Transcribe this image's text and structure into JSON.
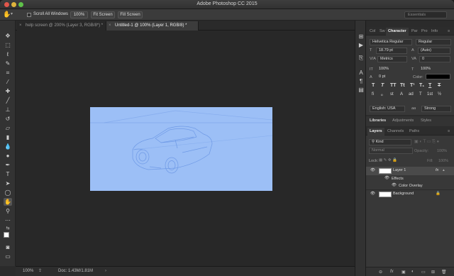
{
  "window": {
    "title": "Adobe Photoshop CC 2015"
  },
  "options_bar": {
    "scroll_all_label": "Scroll All Windows",
    "zoom_100_label": "100%",
    "fit_screen_label": "Fit Screen",
    "fill_screen_label": "Fill Screen",
    "workspace": "Essentials"
  },
  "doc_tabs": [
    {
      "label": "help screen @ 200% (Layer 3, RGB/8*) *",
      "active": false
    },
    {
      "label": "Untitled-1 @ 100% (Layer 1, RGB/8) *",
      "active": true
    }
  ],
  "status": {
    "zoom": "100%",
    "doc_info": "Doc: 1.43M/1.81M"
  },
  "character_panel": {
    "tabs": [
      "Col",
      "Sw",
      "Character",
      "Par",
      "Pro",
      "Info"
    ],
    "font_family": "Helvetica Regular",
    "font_style": "Regular",
    "font_size": "18.79 pt",
    "leading": "(Auto)",
    "kerning": "Metrics",
    "tracking": "0",
    "vertical_scale": "100%",
    "horizontal_scale": "100%",
    "baseline_shift": "0 pt",
    "color_label": "Color:",
    "style_buttons": [
      "T",
      "T",
      "TT",
      "Tt",
      "T¹",
      "T₁",
      "T",
      "T"
    ],
    "opentype_buttons": [
      "fi",
      "ℴ",
      "st",
      "A",
      "ad",
      "T",
      "1st",
      "½"
    ],
    "language": "English: USA",
    "antialias_icon": "aa",
    "antialias": "Strong"
  },
  "libraries_panel": {
    "tabs": [
      "Libraries",
      "Adjustments",
      "Styles"
    ]
  },
  "layers_panel": {
    "tabs": [
      "Layers",
      "Channels",
      "Paths"
    ],
    "kind_label": "Kind",
    "blend_mode": "Normal",
    "opacity_label": "Opacity:",
    "opacity_value": "100%",
    "lock_label": "Lock:",
    "fill_label": "Fill:",
    "fill_value": "100%",
    "layers": [
      {
        "name": "Layer 1",
        "fx": "fx",
        "selected": true
      },
      {
        "name": "Effects",
        "sub": true
      },
      {
        "name": "Color Overlay",
        "sub": true
      },
      {
        "name": "Background",
        "locked": true
      }
    ]
  },
  "colors": {
    "canvas_fill": "#9cbff6",
    "sketch_line": "#6f9ae6",
    "ui_dark": "#282828",
    "panel": "#383838",
    "accent": "#4a78c0"
  }
}
